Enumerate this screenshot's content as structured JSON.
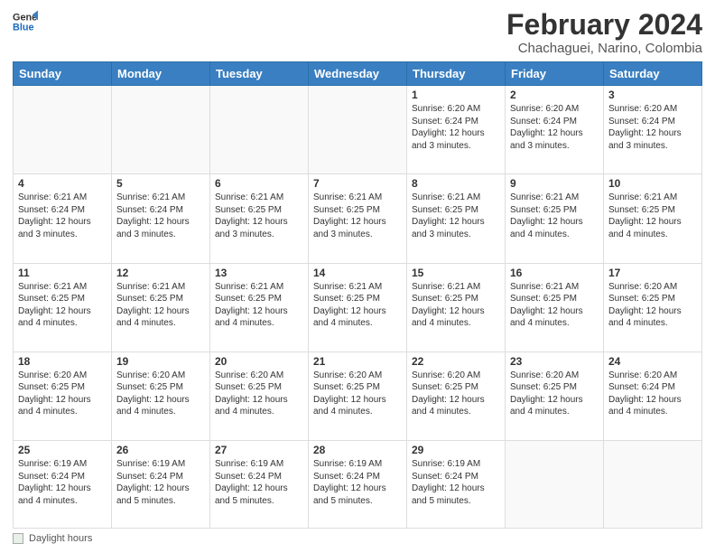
{
  "header": {
    "logo_line1": "General",
    "logo_line2": "Blue",
    "month": "February 2024",
    "location": "Chachaguei, Narino, Colombia"
  },
  "days_of_week": [
    "Sunday",
    "Monday",
    "Tuesday",
    "Wednesday",
    "Thursday",
    "Friday",
    "Saturday"
  ],
  "footer": {
    "label": "Daylight hours"
  },
  "weeks": [
    [
      {
        "num": "",
        "detail": ""
      },
      {
        "num": "",
        "detail": ""
      },
      {
        "num": "",
        "detail": ""
      },
      {
        "num": "",
        "detail": ""
      },
      {
        "num": "1",
        "detail": "Sunrise: 6:20 AM\nSunset: 6:24 PM\nDaylight: 12 hours\nand 3 minutes."
      },
      {
        "num": "2",
        "detail": "Sunrise: 6:20 AM\nSunset: 6:24 PM\nDaylight: 12 hours\nand 3 minutes."
      },
      {
        "num": "3",
        "detail": "Sunrise: 6:20 AM\nSunset: 6:24 PM\nDaylight: 12 hours\nand 3 minutes."
      }
    ],
    [
      {
        "num": "4",
        "detail": "Sunrise: 6:21 AM\nSunset: 6:24 PM\nDaylight: 12 hours\nand 3 minutes."
      },
      {
        "num": "5",
        "detail": "Sunrise: 6:21 AM\nSunset: 6:24 PM\nDaylight: 12 hours\nand 3 minutes."
      },
      {
        "num": "6",
        "detail": "Sunrise: 6:21 AM\nSunset: 6:25 PM\nDaylight: 12 hours\nand 3 minutes."
      },
      {
        "num": "7",
        "detail": "Sunrise: 6:21 AM\nSunset: 6:25 PM\nDaylight: 12 hours\nand 3 minutes."
      },
      {
        "num": "8",
        "detail": "Sunrise: 6:21 AM\nSunset: 6:25 PM\nDaylight: 12 hours\nand 3 minutes."
      },
      {
        "num": "9",
        "detail": "Sunrise: 6:21 AM\nSunset: 6:25 PM\nDaylight: 12 hours\nand 4 minutes."
      },
      {
        "num": "10",
        "detail": "Sunrise: 6:21 AM\nSunset: 6:25 PM\nDaylight: 12 hours\nand 4 minutes."
      }
    ],
    [
      {
        "num": "11",
        "detail": "Sunrise: 6:21 AM\nSunset: 6:25 PM\nDaylight: 12 hours\nand 4 minutes."
      },
      {
        "num": "12",
        "detail": "Sunrise: 6:21 AM\nSunset: 6:25 PM\nDaylight: 12 hours\nand 4 minutes."
      },
      {
        "num": "13",
        "detail": "Sunrise: 6:21 AM\nSunset: 6:25 PM\nDaylight: 12 hours\nand 4 minutes."
      },
      {
        "num": "14",
        "detail": "Sunrise: 6:21 AM\nSunset: 6:25 PM\nDaylight: 12 hours\nand 4 minutes."
      },
      {
        "num": "15",
        "detail": "Sunrise: 6:21 AM\nSunset: 6:25 PM\nDaylight: 12 hours\nand 4 minutes."
      },
      {
        "num": "16",
        "detail": "Sunrise: 6:21 AM\nSunset: 6:25 PM\nDaylight: 12 hours\nand 4 minutes."
      },
      {
        "num": "17",
        "detail": "Sunrise: 6:20 AM\nSunset: 6:25 PM\nDaylight: 12 hours\nand 4 minutes."
      }
    ],
    [
      {
        "num": "18",
        "detail": "Sunrise: 6:20 AM\nSunset: 6:25 PM\nDaylight: 12 hours\nand 4 minutes."
      },
      {
        "num": "19",
        "detail": "Sunrise: 6:20 AM\nSunset: 6:25 PM\nDaylight: 12 hours\nand 4 minutes."
      },
      {
        "num": "20",
        "detail": "Sunrise: 6:20 AM\nSunset: 6:25 PM\nDaylight: 12 hours\nand 4 minutes."
      },
      {
        "num": "21",
        "detail": "Sunrise: 6:20 AM\nSunset: 6:25 PM\nDaylight: 12 hours\nand 4 minutes."
      },
      {
        "num": "22",
        "detail": "Sunrise: 6:20 AM\nSunset: 6:25 PM\nDaylight: 12 hours\nand 4 minutes."
      },
      {
        "num": "23",
        "detail": "Sunrise: 6:20 AM\nSunset: 6:25 PM\nDaylight: 12 hours\nand 4 minutes."
      },
      {
        "num": "24",
        "detail": "Sunrise: 6:20 AM\nSunset: 6:24 PM\nDaylight: 12 hours\nand 4 minutes."
      }
    ],
    [
      {
        "num": "25",
        "detail": "Sunrise: 6:19 AM\nSunset: 6:24 PM\nDaylight: 12 hours\nand 4 minutes."
      },
      {
        "num": "26",
        "detail": "Sunrise: 6:19 AM\nSunset: 6:24 PM\nDaylight: 12 hours\nand 5 minutes."
      },
      {
        "num": "27",
        "detail": "Sunrise: 6:19 AM\nSunset: 6:24 PM\nDaylight: 12 hours\nand 5 minutes."
      },
      {
        "num": "28",
        "detail": "Sunrise: 6:19 AM\nSunset: 6:24 PM\nDaylight: 12 hours\nand 5 minutes."
      },
      {
        "num": "29",
        "detail": "Sunrise: 6:19 AM\nSunset: 6:24 PM\nDaylight: 12 hours\nand 5 minutes."
      },
      {
        "num": "",
        "detail": ""
      },
      {
        "num": "",
        "detail": ""
      }
    ]
  ]
}
